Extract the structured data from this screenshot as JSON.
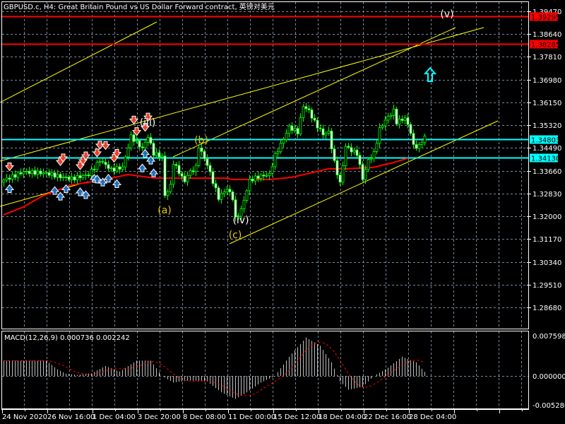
{
  "window": {
    "title": "GBPUSD.c, H4:  Great Britain Pound vs US Dollar Forward contract, 英镑对美元"
  },
  "colors": {
    "background": "#000000",
    "grid": "#778899",
    "candle": "#00ff00",
    "bear_body": "#ffffff",
    "ma": "#ff0000",
    "resistance": "#ff0000",
    "support": "#00ffff",
    "trendline": "#ffff00",
    "macd_hist": "#c0c0c0",
    "macd_signal": "#ff0000",
    "buy_arrow": "#1e6fbf",
    "sell_arrow": "#e8412c",
    "wave_white": "#ffffff",
    "wave_yellow": "#e6c700"
  },
  "chart_data": {
    "type": "candlestick",
    "symbol": "GBPUSD.c",
    "timeframe": "H4",
    "ylim": [
      1.28,
      1.399
    ],
    "y_ticks": [
      "1.39470",
      "1.38640",
      "1.37810",
      "1.36980",
      "1.36150",
      "1.35320",
      "1.34490",
      "1.33660",
      "1.32830",
      "1.32000",
      "1.31170",
      "1.30340",
      "1.29510",
      "1.28680"
    ],
    "x_ticks": [
      "24 Nov 2020",
      "26 Nov 16:00",
      "1 Dec 04:00",
      "3 Dec 20:00",
      "8 Dec 08:00",
      "11 Dec 00:00",
      "15 Dec 12:00",
      "18 Dec 04:00",
      "22 Dec 16:00",
      "28 Dec 04:00"
    ],
    "grid": true,
    "bar_count": 150,
    "close_anchors": [
      [
        0,
        1.3332
      ],
      [
        7,
        1.3362
      ],
      [
        15,
        1.3357
      ],
      [
        20,
        1.3344
      ],
      [
        24,
        1.3337
      ],
      [
        30,
        1.3352
      ],
      [
        34,
        1.3404
      ],
      [
        38,
        1.337
      ],
      [
        42,
        1.3378
      ],
      [
        45,
        1.3491
      ],
      [
        49,
        1.3447
      ],
      [
        51,
        1.3491
      ],
      [
        53,
        1.3429
      ],
      [
        56,
        1.3417
      ],
      [
        57,
        1.3275
      ],
      [
        59,
        1.3311
      ],
      [
        60,
        1.3396
      ],
      [
        64,
        1.3326
      ],
      [
        65,
        1.3352
      ],
      [
        68,
        1.3378
      ],
      [
        69,
        1.3455
      ],
      [
        72,
        1.3388
      ],
      [
        74,
        1.3326
      ],
      [
        76,
        1.3267
      ],
      [
        79,
        1.3301
      ],
      [
        81,
        1.3267
      ],
      [
        82,
        1.319
      ],
      [
        84,
        1.3223
      ],
      [
        87,
        1.3331
      ],
      [
        90,
        1.3344
      ],
      [
        94,
        1.3352
      ],
      [
        96,
        1.3422
      ],
      [
        99,
        1.3481
      ],
      [
        101,
        1.3525
      ],
      [
        104,
        1.3507
      ],
      [
        106,
        1.3602
      ],
      [
        108,
        1.3584
      ],
      [
        110,
        1.3543
      ],
      [
        113,
        1.3499
      ],
      [
        115,
        1.3507
      ],
      [
        117,
        1.3396
      ],
      [
        119,
        1.3319
      ],
      [
        121,
        1.3455
      ],
      [
        123,
        1.344
      ],
      [
        125,
        1.3429
      ],
      [
        127,
        1.3337
      ],
      [
        129,
        1.3404
      ],
      [
        131,
        1.3429
      ],
      [
        133,
        1.3517
      ],
      [
        135,
        1.355
      ],
      [
        138,
        1.3584
      ],
      [
        139,
        1.3543
      ],
      [
        142,
        1.3558
      ],
      [
        144,
        1.3507
      ],
      [
        145,
        1.3455
      ],
      [
        147,
        1.3455
      ],
      [
        149,
        1.3491
      ]
    ],
    "moving_average": [
      [
        0,
        1.3205
      ],
      [
        7,
        1.3234
      ],
      [
        14,
        1.3275
      ],
      [
        24,
        1.3314
      ],
      [
        36,
        1.3334
      ],
      [
        44,
        1.3352
      ],
      [
        54,
        1.3339
      ],
      [
        79,
        1.3339
      ],
      [
        81,
        1.3334
      ],
      [
        94,
        1.3334
      ],
      [
        102,
        1.3342
      ],
      [
        115,
        1.3373
      ],
      [
        121,
        1.3373
      ],
      [
        131,
        1.3378
      ],
      [
        138,
        1.3396
      ],
      [
        143,
        1.3411
      ]
    ],
    "horizontal_levels": [
      {
        "price": "1.39295",
        "kind": "resistance"
      },
      {
        "price": "1.38285",
        "kind": "resistance"
      },
      {
        "price": "1.34803",
        "kind": "support"
      },
      {
        "price": "1.34130",
        "kind": "support"
      }
    ],
    "wave_labels": [
      {
        "text": "(iii)",
        "bar": 51,
        "price": 1.353,
        "color": "white"
      },
      {
        "text": "(b)",
        "bar": 70,
        "price": 1.3465,
        "color": "yellow"
      },
      {
        "text": "(a)",
        "bar": 57,
        "price": 1.321,
        "color": "yellow"
      },
      {
        "text": "(iv)",
        "bar": 84,
        "price": 1.3175,
        "color": "white"
      },
      {
        "text": "(c)",
        "bar": 82,
        "price": 1.312,
        "color": "yellow"
      },
      {
        "text": "(v)",
        "bar": 157,
        "price": 1.3925,
        "color": "white"
      }
    ],
    "buy_signal_bars": [
      2,
      18,
      20,
      22,
      27,
      29,
      32,
      33,
      35,
      37,
      40,
      49,
      50,
      52,
      53
    ],
    "sell_signal_bars": [
      2,
      20,
      21,
      27,
      28,
      29,
      33,
      34,
      36,
      39,
      40,
      46,
      47,
      50,
      51
    ],
    "target_arrow": {
      "direction": "up",
      "bar": 151,
      "price": 1.372
    },
    "macd": {
      "label": "MACD(12,26,9) 0.000736 0.002242",
      "y_ticks": [
        "0.007598",
        "0.000000",
        "-0.005280"
      ],
      "ylim": [
        -0.00528,
        0.007598
      ],
      "main_anchors": [
        [
          0,
          0.0028
        ],
        [
          15,
          0.0028
        ],
        [
          19,
          0.0012
        ],
        [
          22,
          0.0004
        ],
        [
          26,
          0.0002
        ],
        [
          31,
          0.0005
        ],
        [
          36,
          0.0018
        ],
        [
          41,
          0.0008
        ],
        [
          47,
          0.0028
        ],
        [
          52,
          0.0028
        ],
        [
          56,
          0.0
        ],
        [
          60,
          -0.0012
        ],
        [
          66,
          -0.0008
        ],
        [
          72,
          -0.001
        ],
        [
          77,
          -0.003
        ],
        [
          82,
          -0.0042
        ],
        [
          86,
          -0.003
        ],
        [
          91,
          -0.0012
        ],
        [
          96,
          0.0
        ],
        [
          101,
          0.0035
        ],
        [
          107,
          0.007
        ],
        [
          112,
          0.0055
        ],
        [
          116,
          0.0025
        ],
        [
          119,
          -0.001
        ],
        [
          122,
          -0.0025
        ],
        [
          127,
          -0.002
        ],
        [
          131,
          0.0
        ],
        [
          136,
          0.0015
        ],
        [
          141,
          0.0035
        ],
        [
          146,
          0.0025
        ],
        [
          149,
          0.000736
        ]
      ]
    }
  }
}
